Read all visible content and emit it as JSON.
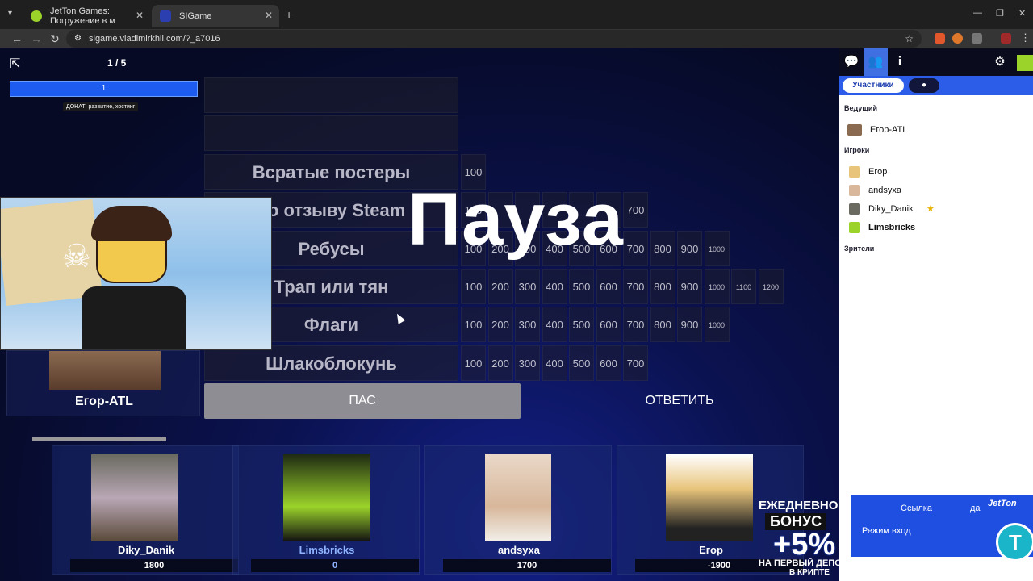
{
  "browser": {
    "tabs": [
      {
        "title": "JetTon Games: Погружение в м"
      },
      {
        "title": "SIGame"
      }
    ],
    "new_tab": "+",
    "url": "sigame.vladimirkhil.com/?_a7016"
  },
  "game": {
    "round_indicator": "1 / 5",
    "progress_value": "1",
    "donate_label": "ДОНАТ: развитие, хостинг",
    "pause_text": "Пауза",
    "themes": [
      {
        "name": "",
        "prices": []
      },
      {
        "name": "",
        "prices": []
      },
      {
        "name": "Всратые постеры",
        "prices": [
          "100"
        ]
      },
      {
        "name": "по отзыву Steam",
        "prices": [
          "100",
          "",
          "",
          "",
          "",
          "",
          "700"
        ]
      },
      {
        "name": "Ребусы",
        "prices": [
          "100",
          "200",
          "300",
          "400",
          "500",
          "600",
          "700",
          "800",
          "900",
          "1000"
        ]
      },
      {
        "name": "Трап или тян",
        "prices": [
          "100",
          "200",
          "300",
          "400",
          "500",
          "600",
          "700",
          "800",
          "900",
          "1000",
          "1100",
          "1200"
        ]
      },
      {
        "name": "Флаги",
        "prices": [
          "100",
          "200",
          "300",
          "400",
          "500",
          "600",
          "700",
          "800",
          "900",
          "1000"
        ]
      },
      {
        "name": "Шлакоблокунь",
        "prices": [
          "100",
          "200",
          "300",
          "400",
          "500",
          "600",
          "700"
        ]
      }
    ],
    "host_name": "Егор-ATL",
    "pass_label": "ПАС",
    "answer_label": "ОТВЕТИТЬ",
    "players": [
      {
        "name": "Diky_Danik",
        "score": "1800",
        "highlight": false
      },
      {
        "name": "Limsbricks",
        "score": "0",
        "highlight": true
      },
      {
        "name": "andsyxa",
        "score": "1700",
        "highlight": false
      },
      {
        "name": "Егор",
        "score": "-1900",
        "highlight": false
      }
    ]
  },
  "sidebar": {
    "participants_tab": "Участники",
    "host_section": "Ведущий",
    "host": "Егор-ATL",
    "players_section": "Игроки",
    "players": [
      "Егор",
      "andsyxa",
      "Diky_Danik",
      "Limsbricks"
    ],
    "viewers_section": "Зрители"
  },
  "promo": {
    "line1": "ЕЖЕДНЕВНО",
    "line2": "БОНУС",
    "line3": "+5%",
    "line4": "НА ПЕРВЫЙ ДЕПОЗИТ",
    "line5": "В КРИПТЕ",
    "brand": "JetTon",
    "link_text": "Ссылка",
    "link_suffix": "да",
    "mode_text": "Режим вход"
  },
  "colors": {
    "accent": "#2b5de8",
    "pass_bg": "#8d8d93",
    "background": "#0b1250"
  }
}
